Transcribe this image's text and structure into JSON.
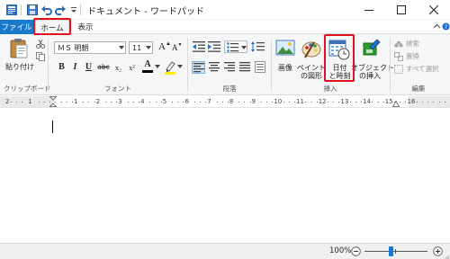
{
  "window": {
    "title": "ドキュメント - ワードパッド"
  },
  "tabs": {
    "file": "ファイル",
    "home": "ホーム",
    "view": "表示"
  },
  "font": {
    "family": "ＭＳ 明朝",
    "size": "11"
  },
  "groups": {
    "clipboard": "クリップボード",
    "font": "フォント",
    "paragraph": "段落",
    "insert": "挿入",
    "edit": "編集"
  },
  "buttons": {
    "paste": "貼り付け",
    "picture": "画像",
    "paint_line1": "ペイント",
    "paint_line2": "の図形",
    "datetime_line1": "日付",
    "datetime_line2": "と時刻",
    "object_line1": "オブジェクト",
    "object_line2": "の挿入",
    "find": "検索",
    "replace": "置換",
    "select_all": "すべて選択",
    "bold": "B",
    "italic": "I",
    "underline": "U",
    "strike": "abc",
    "subscript": "x₂",
    "superscript": "x²",
    "grow": "A",
    "shrink": "A",
    "color": "A"
  },
  "ruler": {
    "numbers": [
      "2",
      "1",
      "1",
      "2",
      "3",
      "4",
      "5",
      "6",
      "7",
      "8",
      "9",
      "10",
      "11",
      "12",
      "13",
      "14",
      "15",
      "16"
    ]
  },
  "status": {
    "zoom": "100%"
  },
  "colors": {
    "accent": "#1979ca",
    "highlight": "#e0121b"
  }
}
